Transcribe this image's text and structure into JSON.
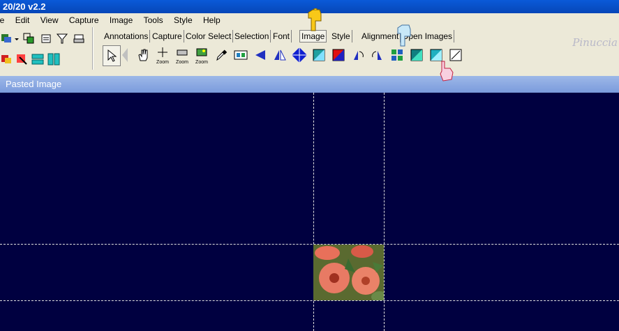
{
  "window": {
    "title": "20/20 v2.2"
  },
  "menu": [
    "le",
    "Edit",
    "View",
    "Capture",
    "Image",
    "Tools",
    "Style",
    "Help"
  ],
  "tabs": [
    {
      "label": "Annotations"
    },
    {
      "label": "Capture"
    },
    {
      "label": "Color Select"
    },
    {
      "label": "Selection"
    },
    {
      "label": "Font"
    },
    {
      "label": "Image",
      "active": true
    },
    {
      "label": "Style"
    },
    {
      "label": "Alignment"
    },
    {
      "label": "Open Images"
    }
  ],
  "tools": {
    "zoom_labels": [
      "Zoom",
      "Zoom",
      "Zoom"
    ]
  },
  "watermark": "Pinuccia",
  "document": {
    "title": "Pasted Image"
  },
  "colors": {
    "canvas": "#000040",
    "titlebar": "#0646b8",
    "docbar": "#7b9bdc"
  }
}
